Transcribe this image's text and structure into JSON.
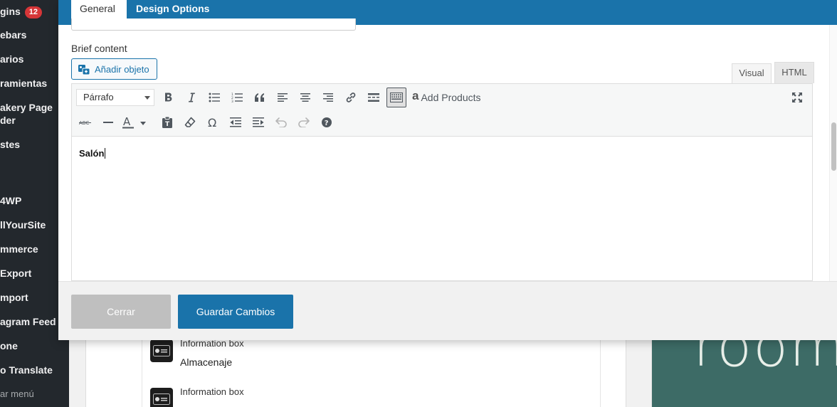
{
  "sidebar": {
    "items": [
      {
        "label": "gins",
        "badge": "12"
      },
      {
        "label": "ebars"
      },
      {
        "label": "arios"
      },
      {
        "label": "ramientas"
      },
      {
        "label": "akery Page"
      },
      {
        "label": "der"
      },
      {
        "label": "stes"
      },
      {
        "label": "4WP"
      },
      {
        "label": "llYourSite"
      },
      {
        "label": "mmerce"
      },
      {
        "label": "Export"
      },
      {
        "label": "mport"
      },
      {
        "label": "agram Feed"
      },
      {
        "label": "one"
      },
      {
        "label": "o Translate"
      },
      {
        "label": "ar menú"
      }
    ]
  },
  "modal": {
    "tabs": [
      {
        "label": "General",
        "active": true
      },
      {
        "label": "Design Options",
        "active": false
      }
    ],
    "field_label": "Brief content",
    "add_object_label": "Añadir objeto",
    "editor_tabs": {
      "visual": "Visual",
      "html": "HTML"
    },
    "toolbar": {
      "format_value": "Párrafo",
      "add_products_label": "Add Products"
    },
    "content": "Salón",
    "footer": {
      "close_label": "Cerrar",
      "save_label": "Guardar Cambios"
    }
  },
  "background": {
    "items": [
      {
        "label": "Information box",
        "title": "Almacenaje"
      },
      {
        "label": "Information box",
        "title": ""
      }
    ],
    "image_text": "room"
  },
  "colors": {
    "accent": "#1a73aa",
    "sidebar_bg": "#23282d",
    "badge": "#d63638",
    "close_button": "#bfbfbf",
    "image_bg": "#3d6b66"
  }
}
